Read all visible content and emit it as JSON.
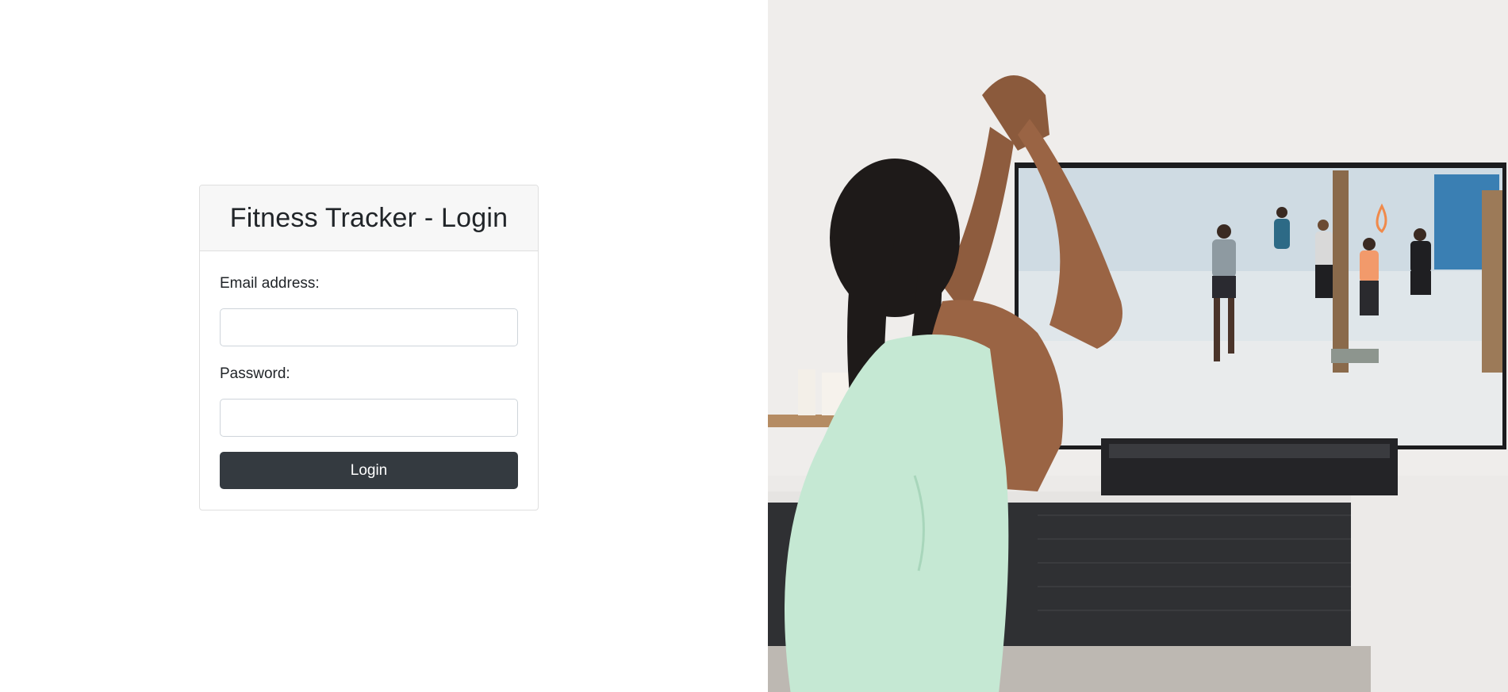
{
  "login": {
    "title": "Fitness Tracker - Login",
    "email_label": "Email address:",
    "email_value": "",
    "password_label": "Password:",
    "password_value": "",
    "submit_label": "Login"
  },
  "colors": {
    "button_bg": "#343a40",
    "card_header_bg": "#f7f7f7",
    "card_border": "#dfdfdf"
  }
}
